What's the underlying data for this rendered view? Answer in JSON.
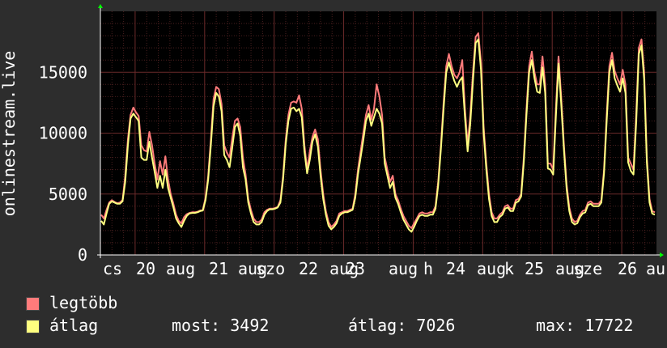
{
  "chart_data": {
    "type": "line",
    "ylabel": "onlinestream.live",
    "ylim": [
      0,
      20000
    ],
    "yticks": [
      0,
      5000,
      10000,
      15000
    ],
    "x_tick_labels": [
      "cs",
      "20",
      "aug",
      "21",
      "aug",
      "szo",
      "22",
      "aug",
      "23",
      "aug",
      "h",
      "24",
      "aug",
      "k",
      "25",
      "aug",
      "sze",
      "26",
      "au"
    ],
    "grid": true,
    "colors": {
      "background": "#2d2d2d",
      "plot_bg": "#000000",
      "grid_minor": "#4a1f1f",
      "grid_major": "#6a2a2a",
      "max_line": "#ff7b7b",
      "avg_line": "#ffff80",
      "axis": "#ffffff",
      "arrow": "#00ff00"
    },
    "series": [
      {
        "name": "legtöbb",
        "values": [
          3300,
          3000,
          3700,
          4300,
          4500,
          4350,
          4250,
          4300,
          4500,
          6500,
          9500,
          11500,
          12100,
          11700,
          11400,
          9000,
          8600,
          8500,
          10100,
          9000,
          7500,
          6200,
          7700,
          6600,
          8100,
          6200,
          5000,
          4200,
          3300,
          2800,
          2600,
          3100,
          3350,
          3450,
          3500,
          3500,
          3550,
          3650,
          3700,
          4700,
          6500,
          9500,
          12800,
          13800,
          13600,
          12400,
          9000,
          8400,
          8000,
          9600,
          11000,
          11200,
          10500,
          8000,
          6600,
          4600,
          3700,
          3000,
          2700,
          2700,
          2900,
          3500,
          3700,
          3800,
          3800,
          3850,
          3950,
          4500,
          6500,
          9500,
          11500,
          12500,
          12600,
          12500,
          13100,
          12000,
          9000,
          7000,
          8500,
          9700,
          10300,
          9500,
          7000,
          5000,
          3600,
          2700,
          2300,
          2500,
          2800,
          3400,
          3500,
          3600,
          3600,
          3700,
          3800,
          5000,
          7000,
          8500,
          10000,
          11500,
          12300,
          11100,
          12000,
          14000,
          13000,
          11500,
          8000,
          7000,
          6000,
          6500,
          5000,
          4500,
          3800,
          3200,
          2800,
          2400,
          2200,
          2600,
          3000,
          3400,
          3500,
          3400,
          3400,
          3500,
          3500,
          4000,
          6000,
          9000,
          12500,
          15500,
          16500,
          15500,
          14800,
          14500,
          15000,
          16000,
          12000,
          9000,
          11500,
          15000,
          17900,
          18200,
          15800,
          10500,
          7500,
          5000,
          3500,
          3000,
          3000,
          3300,
          3500,
          4000,
          4100,
          3800,
          3800,
          4500,
          4600,
          5000,
          8000,
          12000,
          15500,
          16700,
          15000,
          14000,
          14000,
          16300,
          14000,
          7500,
          7500,
          7000,
          12000,
          16300,
          13000,
          9000,
          5800,
          3900,
          3000,
          2700,
          2800,
          3300,
          3600,
          3700,
          4300,
          4400,
          4200,
          4200,
          4200,
          4500,
          7000,
          11500,
          15500,
          16600,
          15100,
          14500,
          14000,
          15200,
          14000,
          8000,
          7500,
          7000,
          11500,
          17000,
          17700,
          15000,
          8000,
          4600,
          3600,
          3500
        ]
      },
      {
        "name": "átlag",
        "values": [
          2800,
          2500,
          3400,
          4200,
          4400,
          4300,
          4200,
          4200,
          4400,
          6000,
          9000,
          11200,
          11600,
          11300,
          11000,
          8000,
          7800,
          7800,
          9300,
          8000,
          6800,
          5500,
          6500,
          5500,
          7000,
          5500,
          4700,
          3900,
          3000,
          2600,
          2300,
          2800,
          3200,
          3400,
          3450,
          3450,
          3500,
          3600,
          3650,
          4500,
          6200,
          9000,
          12200,
          13300,
          13000,
          11800,
          8200,
          7800,
          7200,
          8800,
          10500,
          10800,
          9800,
          7200,
          6200,
          4300,
          3400,
          2700,
          2500,
          2500,
          2700,
          3300,
          3600,
          3750,
          3750,
          3800,
          3900,
          4300,
          6200,
          9100,
          11000,
          12000,
          12100,
          11800,
          12000,
          11300,
          8500,
          6700,
          7800,
          9300,
          9900,
          8900,
          6500,
          4600,
          3300,
          2400,
          2100,
          2300,
          2600,
          3200,
          3400,
          3500,
          3500,
          3600,
          3700,
          4700,
          6600,
          8000,
          9400,
          11000,
          11600,
          10600,
          11300,
          12000,
          11600,
          10800,
          7500,
          6500,
          5500,
          6000,
          4700,
          4200,
          3500,
          2900,
          2500,
          2100,
          1900,
          2300,
          2800,
          3200,
          3300,
          3200,
          3200,
          3300,
          3300,
          3800,
          5700,
          8700,
          12000,
          15000,
          15800,
          15000,
          14300,
          13800,
          14300,
          14600,
          11300,
          8500,
          10800,
          14300,
          17400,
          17700,
          15200,
          10000,
          7000,
          4600,
          3200,
          2700,
          2700,
          3100,
          3300,
          3800,
          3900,
          3600,
          3600,
          4300,
          4400,
          4800,
          7600,
          11500,
          15000,
          16000,
          14500,
          13400,
          13300,
          15400,
          13300,
          7100,
          7000,
          6600,
          11300,
          15700,
          12400,
          8600,
          5400,
          3600,
          2700,
          2500,
          2600,
          3100,
          3400,
          3500,
          4100,
          4200,
          4000,
          4000,
          4000,
          4300,
          6700,
          11000,
          15000,
          16000,
          14500,
          13900,
          13400,
          14500,
          13300,
          7600,
          6900,
          6600,
          10800,
          16500,
          17200,
          14400,
          7600,
          4300,
          3400,
          3300
        ]
      }
    ]
  },
  "legend": {
    "max_label": "legtöbb",
    "avg_label": "átlag",
    "current": "most: 3492",
    "average": "átlag: 7026",
    "maximum": "max: 17722"
  }
}
